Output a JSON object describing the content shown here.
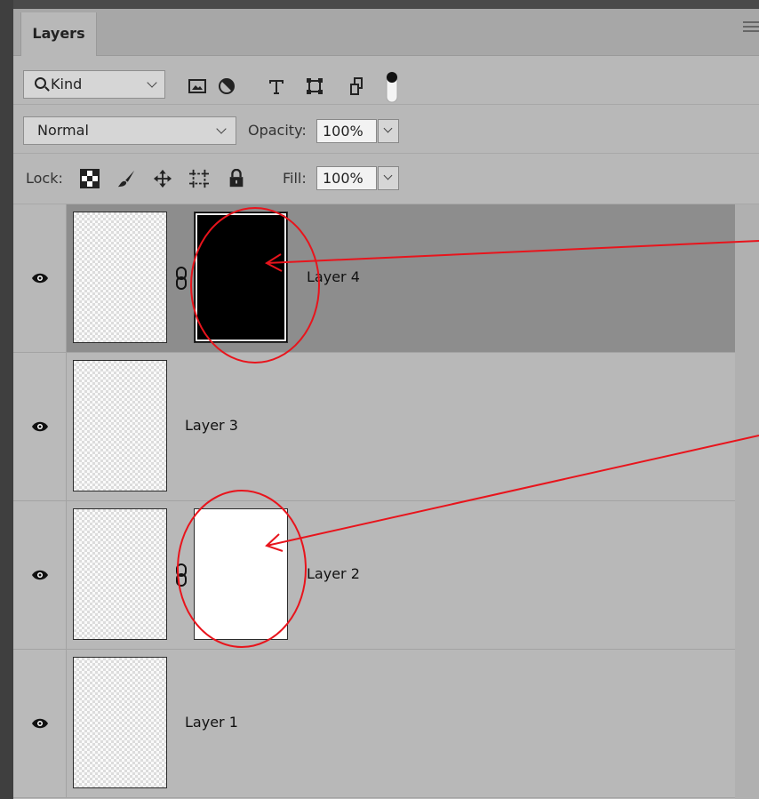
{
  "panel": {
    "tab_label": "Layers",
    "menu_icon": "hamburger-menu-icon"
  },
  "filter": {
    "kind_label": "Kind",
    "icons": [
      "image-filter-icon",
      "adjustment-filter-icon",
      "type-filter-icon",
      "shape-filter-icon",
      "smart-object-filter-icon",
      "filter-toggle-icon"
    ]
  },
  "blend": {
    "mode": "Normal",
    "opacity_label": "Opacity:",
    "opacity_value": "100%"
  },
  "lock": {
    "label": "Lock:",
    "icons": [
      "lock-transparent-pixels-icon",
      "lock-image-pixels-icon",
      "lock-position-icon",
      "lock-artboard-icon",
      "lock-all-icon"
    ],
    "fill_label": "Fill:",
    "fill_value": "100%"
  },
  "layers": [
    {
      "name": "Layer 4",
      "selected": true,
      "mask": "black",
      "visible": true
    },
    {
      "name": "Layer 3",
      "selected": false,
      "mask": null,
      "visible": true
    },
    {
      "name": "Layer 2",
      "selected": false,
      "mask": "white",
      "visible": true
    },
    {
      "name": "Layer 1",
      "selected": false,
      "mask": null,
      "visible": true
    }
  ],
  "colors": {
    "panel_bg": "#b8b8b8",
    "selected_row": "#8d8d8d",
    "annotation": "#e8141c"
  }
}
